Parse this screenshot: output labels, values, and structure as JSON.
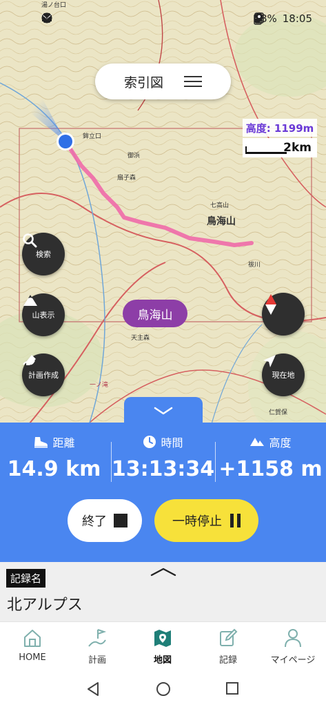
{
  "status_bar": {
    "battery": "58%",
    "time": "18:05"
  },
  "map": {
    "index_button_label": "索引図",
    "altitude_overlay": "高度: 1199m",
    "scale_label": "2km",
    "place_label": "鳥海山",
    "buttons": {
      "search": "検索",
      "mountains": "山表示",
      "plan_create": "計画作成",
      "current_location": "現在地"
    },
    "map_text": [
      "鳥海山",
      "七高山",
      "湯ノ台口",
      "鉾立口",
      "御浜",
      "扇子森",
      "一ノ滝",
      "天主森",
      "祓川",
      "仁賀保"
    ]
  },
  "stats": {
    "distance": {
      "label": "距離",
      "value": "14.9 km"
    },
    "time": {
      "label": "時間",
      "value": "13:13:34"
    },
    "altitude": {
      "label": "高度",
      "value": "+1158 m"
    }
  },
  "controls": {
    "end_label": "終了",
    "pause_label": "一時停止"
  },
  "record": {
    "label": "記録名",
    "name": "北アルプス"
  },
  "bottom_nav": {
    "items": [
      {
        "label": "HOME",
        "icon": "home-icon"
      },
      {
        "label": "計画",
        "icon": "route-flag-icon"
      },
      {
        "label": "地図",
        "icon": "map-icon",
        "active": true
      },
      {
        "label": "記録",
        "icon": "edit-icon"
      },
      {
        "label": "マイページ",
        "icon": "person-icon"
      }
    ]
  },
  "colors": {
    "panel_blue": "#4a86f0",
    "pause_yellow": "#f7e13a",
    "place_purple": "#8d3ea7",
    "track_pink": "#f06aa8",
    "altitude_purple": "#6a3ad6",
    "nav_active": "#1f7f78"
  }
}
